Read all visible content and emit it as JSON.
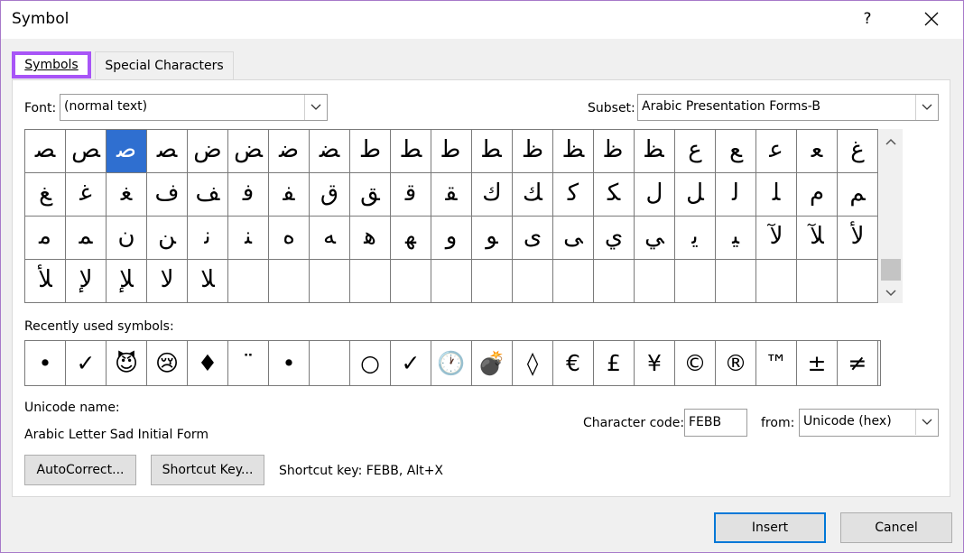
{
  "window": {
    "title": "Symbol",
    "help_label": "?"
  },
  "tabs": [
    {
      "label": "Symbols",
      "active": true
    },
    {
      "label": "Special Characters",
      "active": false
    }
  ],
  "font": {
    "label": "Font:",
    "value": "(normal text)"
  },
  "subset": {
    "label": "Subset:",
    "value": "Arabic Presentation Forms-B"
  },
  "symbol_grid": {
    "selected_row": 0,
    "selected_col": 2,
    "rows": [
      [
        "ﺼ",
        "ﺺ",
        "ﺻ",
        "ﺼ",
        "ﺽ",
        "ﺾ",
        "ﺿ",
        "ﻀ",
        "ﻁ",
        "ﻂ",
        "ﻃ",
        "ﻄ",
        "ﻅ",
        "ﻆ",
        "ﻇ",
        "ﻈ",
        "ﻉ",
        "ﻊ",
        "ﻋ",
        "ﻌ",
        "ﻍ"
      ],
      [
        "ﻎ",
        "ﻏ",
        "ﻐ",
        "ﻑ",
        "ﻒ",
        "ﻓ",
        "ﻔ",
        "ﻕ",
        "ﻖ",
        "ﻗ",
        "ﻘ",
        "ﻙ",
        "ﻚ",
        "ﻛ",
        "ﻜ",
        "ﻝ",
        "ﻞ",
        "ﻟ",
        "ﻠ",
        "ﻡ",
        "ﻢ"
      ],
      [
        "ﻣ",
        "ﻤ",
        "ﻥ",
        "ﻦ",
        "ﻧ",
        "ﻨ",
        "ﻩ",
        "ﻪ",
        "ﻫ",
        "ﻬ",
        "ﻭ",
        "ﻮ",
        "ﻯ",
        "ﻰ",
        "ﻱ",
        "ﻲ",
        "ﻳ",
        "ﻴ",
        "ﻵ",
        "ﻶ",
        "ﻷ"
      ],
      [
        "ﻸ",
        "ﻹ",
        "ﻺ",
        "ﻻ",
        "ﻼ",
        "",
        "",
        "",
        "",
        "",
        "",
        "",
        "",
        "",
        "",
        "",
        "",
        "",
        "",
        "",
        ""
      ]
    ]
  },
  "recent": {
    "label": "Recently used symbols:",
    "symbols": [
      "•",
      "✓",
      "😈",
      "😢",
      "♦",
      "¨",
      "•",
      "",
      "○",
      "✓",
      "🕐",
      "💣",
      "◊",
      "€",
      "£",
      "¥",
      "©",
      "®",
      "™",
      "±",
      "≠"
    ]
  },
  "unicode_name": {
    "label": "Unicode name:",
    "value": "Arabic Letter Sad Initial Form"
  },
  "char_code": {
    "label": "Character code:",
    "value": "FEBB"
  },
  "from": {
    "label": "from:",
    "value": "Unicode (hex)"
  },
  "buttons": {
    "autocorrect": "AutoCorrect...",
    "shortcut_key": "Shortcut Key...",
    "insert": "Insert",
    "cancel": "Cancel"
  },
  "shortcut_text": "Shortcut key: FEBB, Alt+X",
  "icons": {
    "close": "close-icon",
    "dropdown": "chevron-down-icon",
    "scroll_up": "chevron-up-icon",
    "scroll_down": "chevron-down-icon"
  },
  "colors": {
    "selection": "#2f6fd0",
    "tab_highlight": "#a855f7",
    "default_button_border": "#0078d7"
  }
}
